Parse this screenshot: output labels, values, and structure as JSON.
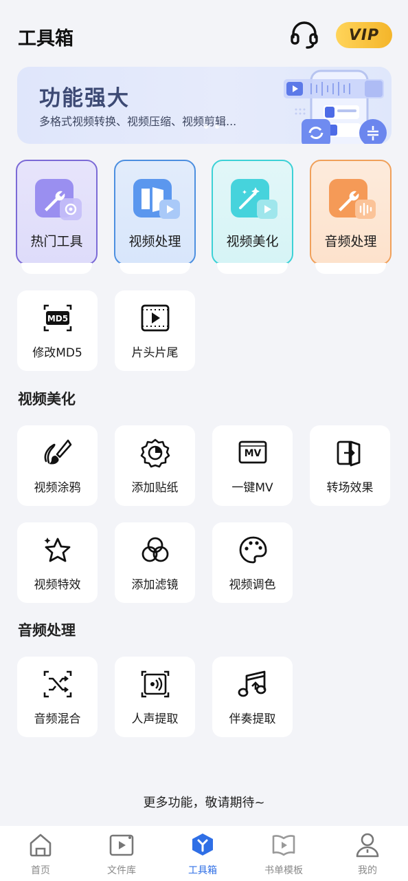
{
  "header": {
    "title": "工具箱",
    "vip_label": "VIP"
  },
  "banner": {
    "title": "功能强大",
    "subtitle": "多格式视频转换、视频压缩、视频剪辑..."
  },
  "categories": [
    {
      "label": "热门工具",
      "icon": "wrench-tools-icon"
    },
    {
      "label": "视频处理",
      "icon": "video-processing-icon"
    },
    {
      "label": "视频美化",
      "icon": "magic-wand-video-icon"
    },
    {
      "label": "音频处理",
      "icon": "wrench-audio-icon"
    }
  ],
  "hot_tools": [
    {
      "label": "修改MD5",
      "icon": "md5-icon"
    },
    {
      "label": "片头片尾",
      "icon": "clip-play-icon"
    }
  ],
  "sections": {
    "video_beauty": "视频美化",
    "audio_processing": "音频处理"
  },
  "video_beauty_tools": [
    {
      "label": "视频涂鸦",
      "icon": "brush-icon"
    },
    {
      "label": "添加贴纸",
      "icon": "sticker-icon"
    },
    {
      "label": "一键MV",
      "icon": "mv-icon"
    },
    {
      "label": "转场效果",
      "icon": "transition-icon"
    },
    {
      "label": "视频特效",
      "icon": "star-sparkle-icon"
    },
    {
      "label": "添加滤镜",
      "icon": "filter-icon"
    },
    {
      "label": "视频调色",
      "icon": "palette-icon"
    }
  ],
  "audio_tools": [
    {
      "label": "音频混合",
      "icon": "shuffle-icon"
    },
    {
      "label": "人声提取",
      "icon": "voice-extract-icon"
    },
    {
      "label": "伴奏提取",
      "icon": "music-upload-icon"
    }
  ],
  "footer_note": "更多功能，敬请期待~",
  "bottom_nav": [
    {
      "label": "首页",
      "icon": "home-icon"
    },
    {
      "label": "文件库",
      "icon": "file-library-icon"
    },
    {
      "label": "工具箱",
      "icon": "toolbox-icon",
      "active": true
    },
    {
      "label": "书单模板",
      "icon": "book-template-icon"
    },
    {
      "label": "我的",
      "icon": "profile-icon"
    }
  ],
  "colors": {
    "accent": "#2f6fe6",
    "vip": "#f4b52a",
    "background": "#f3f4f8"
  }
}
